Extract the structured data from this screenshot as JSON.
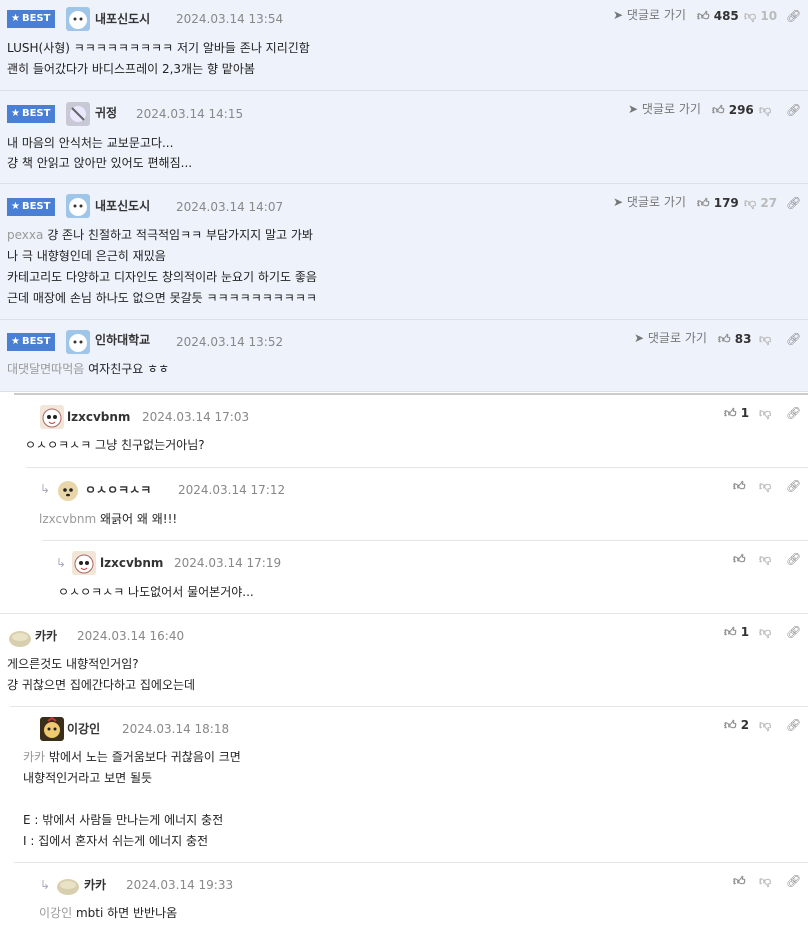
{
  "ui": {
    "goto_label": "댓글로 가기"
  },
  "c1": {
    "badge": "BEST",
    "nick": "내포신도시",
    "date": "2024.03.14 13:54",
    "likes": "485",
    "dislikes": "10",
    "lines": [
      "LUSH(사형) ㅋㅋㅋㅋㅋㅋㅋㅋㅋ 저기 알바들 존나 지리긴함",
      "괜히 들어갔다가 바디스프레이 2,3개는 향 맡아봄"
    ]
  },
  "c2": {
    "badge": "BEST",
    "nick": "귀정",
    "date": "2024.03.14 14:15",
    "likes": "296",
    "lines": [
      "내 마음의 안식처는 교보문고다...",
      "걍 책 안읽고 앉아만 있어도 편해짐..."
    ]
  },
  "c3": {
    "badge": "BEST",
    "nick": "내포신도시",
    "date": "2024.03.14 14:07",
    "likes": "179",
    "dislikes": "27",
    "ref": "pexxa",
    "lines": [
      "걍 존나 친절하고 적극적임ㅋㅋ 부담가지지 말고 가봐",
      "나 극 내향형인데 은근히 재밌음",
      "카테고리도 다양하고 디자인도 창의적이라 눈요기 하기도 좋음",
      "근데 매장에 손님 하나도 없으면 못갈듯 ㅋㅋㅋㅋㅋㅋㅋㅋㅋㅋ"
    ]
  },
  "c4": {
    "badge": "BEST",
    "nick": "인하대학교",
    "date": "2024.03.14 13:52",
    "likes": "83",
    "ref": "대댓달면따먹음",
    "lines": [
      "여자친구요 ㅎㅎ"
    ]
  },
  "c5": {
    "nick": "lzxcvbnm",
    "date": "2024.03.14 17:03",
    "likes": "1",
    "lines": [
      "ㅇㅅㅇㅋㅅㅋ 그냥 친구없는거아님?"
    ]
  },
  "c6": {
    "nick": "ㅇㅅㅇㅋㅅㅋ",
    "date": "2024.03.14 17:12",
    "ref": "lzxcvbnm",
    "lines": [
      "왜긁어 왜 왜!!!"
    ]
  },
  "c7": {
    "nick": "lzxcvbnm",
    "date": "2024.03.14 17:19",
    "lines": [
      "ㅇㅅㅇㅋㅅㅋ 나도없어서 물어본거야..."
    ]
  },
  "c8": {
    "nick": "카카",
    "date": "2024.03.14 16:40",
    "likes": "1",
    "lines": [
      "게으른것도 내향적인거임?",
      "걍 귀찮으면 집에간다하고 집에오는데"
    ]
  },
  "c9": {
    "nick": "이강인",
    "date": "2024.03.14 18:18",
    "likes": "2",
    "ref": "카카",
    "lines": [
      "밖에서 노는 즐거움보다 귀찮음이 크면",
      "내향적인거라고 보면 될듯",
      "",
      "E : 밖에서 사람들 만나는게 에너지 충전",
      "I : 집에서 혼자서 쉬는게 에너지 충전"
    ]
  },
  "c10": {
    "nick": "카카",
    "date": "2024.03.14 19:33",
    "ref": "이강인",
    "lines": [
      "mbti 하면 반반나옴"
    ]
  },
  "colors": {
    "best_bg": "#eef2fb",
    "badge": "#4a7fd6"
  },
  "icons": [
    "star-icon",
    "send-icon",
    "thumbs-up-icon",
    "thumbs-down-icon",
    "link-icon",
    "reply-arrow-icon"
  ]
}
